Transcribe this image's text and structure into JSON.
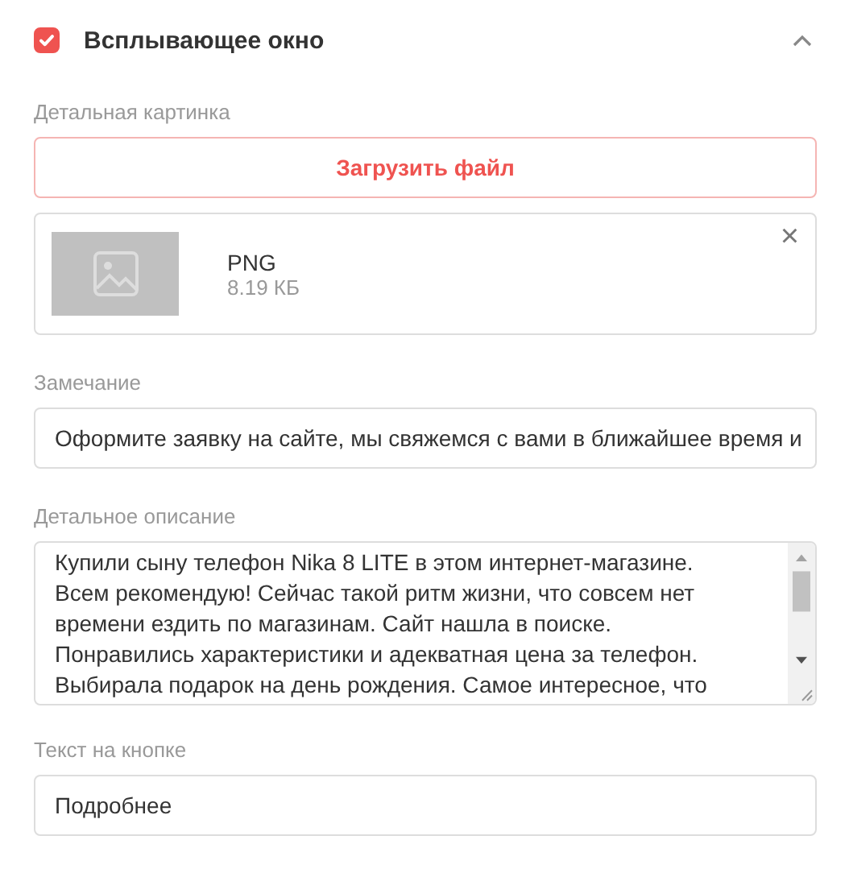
{
  "section": {
    "title": "Всплывающее окно",
    "checked": true,
    "expanded": true
  },
  "image_field": {
    "label": "Детальная картинка",
    "upload_button": "Загрузить файл",
    "file": {
      "kind": "picture",
      "format": "PNG",
      "size": "8.19 КБ",
      "remove": "×"
    }
  },
  "note_field": {
    "label": "Замечание",
    "value": "Оформите заявку на сайте, мы свяжемся с вами в ближайшее время и"
  },
  "description_field": {
    "label": "Детальное описание",
    "lines": [
      "Купили сыну телефон Nika 8 LITE в этом интернет-магазине.",
      "Всем рекомендую! Сейчас такой ритм жизни, что совсем нет",
      "времени ездить по магазинам. Сайт нашла в поиске.",
      "Понравились характеристики и адекватная цена за телефон.",
      "Выбирала подарок на день рождения. Самое интересное, что"
    ]
  },
  "button_text_field": {
    "label": "Текст на кнопке",
    "value": "Подробнее"
  }
}
